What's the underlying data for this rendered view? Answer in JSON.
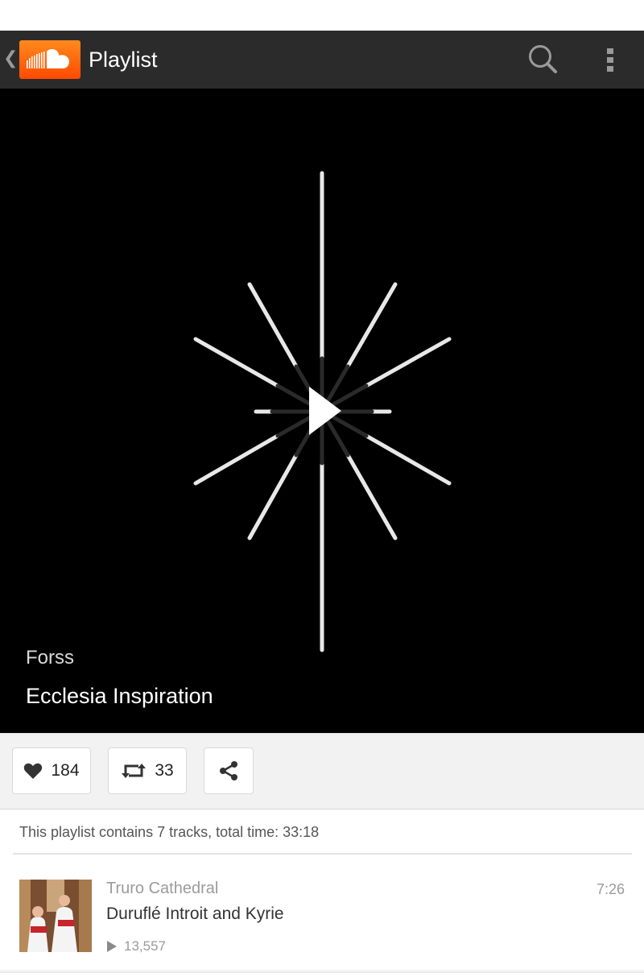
{
  "header": {
    "title": "Playlist",
    "icons": [
      "back-chevron-icon",
      "soundcloud-logo",
      "search-icon",
      "overflow-menu-icon"
    ],
    "accent": "#ff5500",
    "bar_color": "#2b2b2b"
  },
  "playlist": {
    "artist": "Forss",
    "title": "Ecclesia Inspiration"
  },
  "actions": {
    "likes": "184",
    "reposts": "33",
    "share_icon": "share-icon"
  },
  "summary": "This playlist contains 7 tracks, total time: 33:18",
  "tracks": [
    {
      "artist": "Truro Cathedral",
      "title": "Duruflé  Introit and Kyrie",
      "plays": "13,557",
      "duration": "7:26"
    }
  ]
}
